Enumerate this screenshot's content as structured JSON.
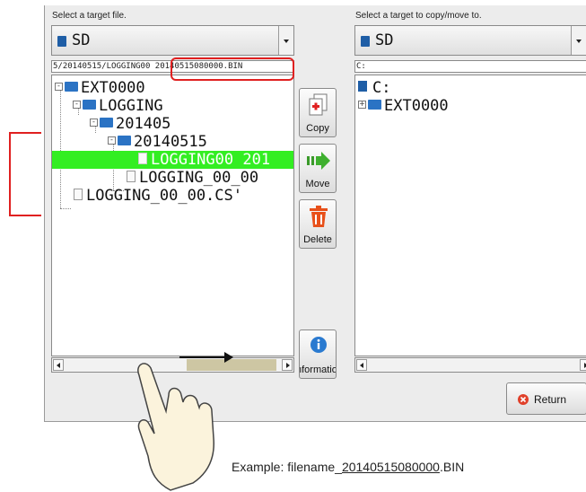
{
  "left_panel": {
    "label": "Select a target file.",
    "drive": "SD",
    "path_prefix": "5/20140515/LOGGING00 ",
    "path_highlight": "20140515080000.BIN",
    "tree": [
      {
        "expander": "-",
        "type": "folder",
        "label": "EXT0000"
      },
      {
        "expander": "-",
        "type": "folder",
        "label": "LOGGING"
      },
      {
        "expander": "-",
        "type": "folder",
        "label": "201405"
      },
      {
        "expander": "-",
        "type": "folder",
        "label": "20140515"
      },
      {
        "type": "file",
        "label": "LOGGING00 201",
        "selected": true
      },
      {
        "type": "file",
        "label": "LOGGING_00_00"
      },
      {
        "type": "file",
        "label": "LOGGING_00_00.CS'"
      }
    ]
  },
  "right_panel": {
    "label": "Select a target to copy/move to.",
    "drive": "SD",
    "path": "C:",
    "tree": [
      {
        "type": "drive",
        "label": "C:"
      },
      {
        "expander": "+",
        "type": "folder",
        "label": "EXT0000"
      }
    ]
  },
  "buttons": {
    "copy": "Copy",
    "move": "Move",
    "delete": "Delete",
    "information": "nformation",
    "return": "Return"
  },
  "colors": {
    "selected_row": "#33ee22",
    "highlight": "#e02020",
    "folder": "#2b73c4"
  },
  "caption": {
    "prefix": "Example: filename_",
    "underlined": "20140515080000",
    "suffix": ".BIN"
  }
}
